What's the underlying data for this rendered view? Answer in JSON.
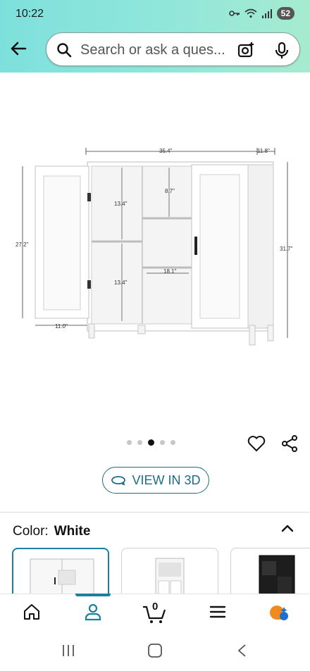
{
  "status": {
    "time": "10:22",
    "battery": "52"
  },
  "search": {
    "placeholder": "Search or ask a ques..."
  },
  "product": {
    "dims": {
      "width": "35.4\"",
      "depth": "11.8\"",
      "height_total": "31.7\"",
      "height_door": "27.2\"",
      "shelf_top": "13.4\"",
      "shelf_bottom": "13.4\"",
      "shelf_small": "8.7\"",
      "shelf_mid": "18.1\"",
      "door_width": "11.0\""
    },
    "image_count": 5,
    "image_active_index": 2
  },
  "view3d": {
    "label": "VIEW IN 3D"
  },
  "color": {
    "label": "Color:",
    "value": "White"
  },
  "nav": {
    "cart_count": "0"
  },
  "colors": {
    "accent": "#1b7fa0",
    "link": "#1a6f86",
    "header_start": "#7ee0dc",
    "header_end": "#a6ebd0"
  }
}
